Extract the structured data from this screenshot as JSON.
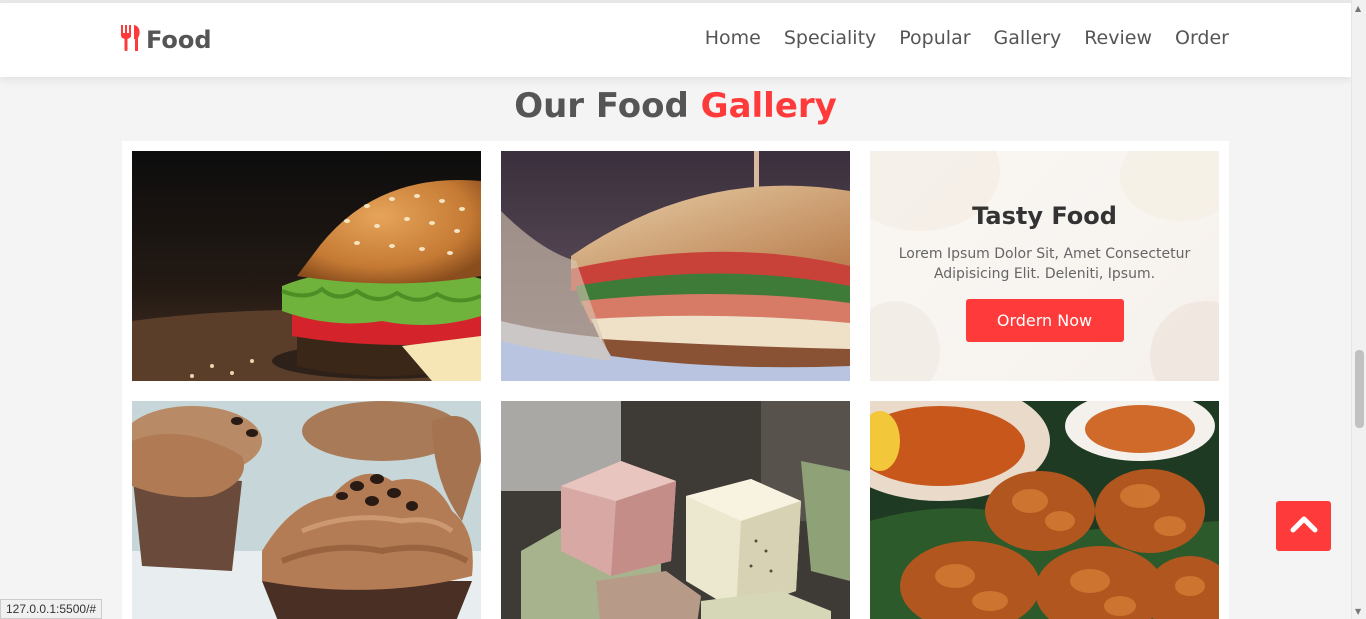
{
  "header": {
    "logo_text": "Food",
    "nav": [
      "Home",
      "Speciality",
      "Popular",
      "Gallery",
      "Review",
      "Order"
    ]
  },
  "section": {
    "title_main": "Our Food",
    "title_accent": "Gallery"
  },
  "gallery": {
    "promo": {
      "title": "Tasty Food",
      "text": "Lorem Ipsum Dolor Sit, Amet Consectetur Adipisicing Elit. Deleniti, Ipsum.",
      "button": "Ordern Now"
    },
    "images": [
      "burger",
      "sandwich",
      "cupcakes",
      "fudge-cubes",
      "fried-chicken"
    ]
  },
  "status_bar": {
    "url": "127.0.0.1:5500/#"
  },
  "colors": {
    "accent": "#ff3a3a",
    "text": "#555555",
    "background": "#f4f4f4"
  },
  "icons": {
    "logo": "utensils-icon",
    "scroll_top": "chevron-up-icon"
  }
}
